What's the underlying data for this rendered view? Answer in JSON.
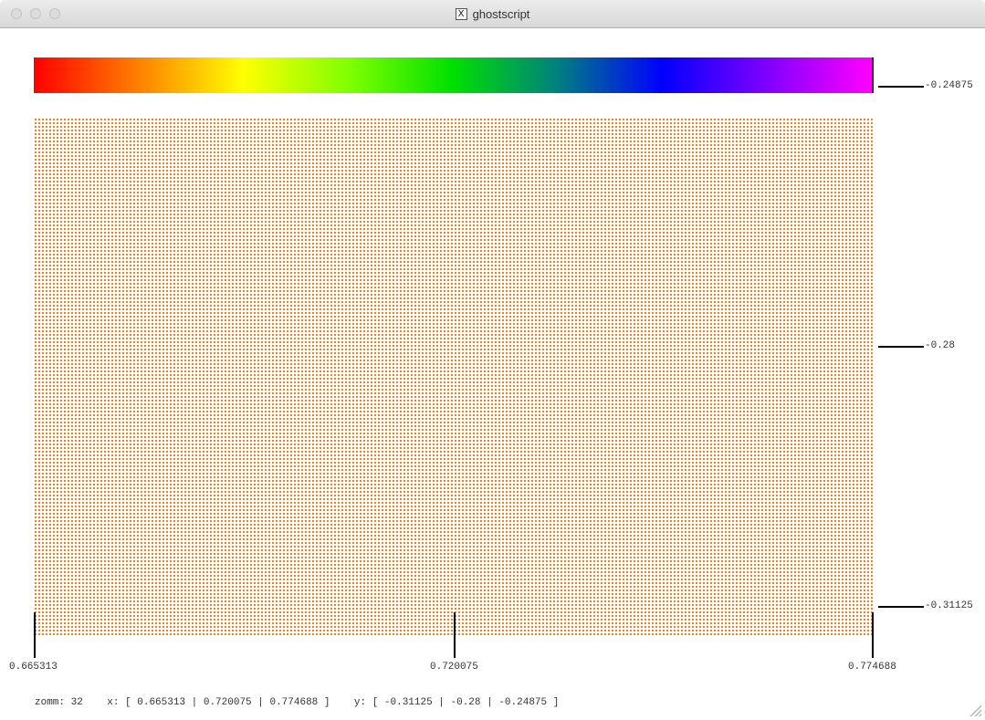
{
  "window": {
    "title": "ghostscript",
    "title_icon": "x11-icon",
    "title_icon_glyph": "X"
  },
  "colorbar": {
    "stops": [
      "#ff0000",
      "#ff8000",
      "#ffff00",
      "#80ff00",
      "#00e000",
      "#008080",
      "#0000ff",
      "#8000ff",
      "#ff00ff"
    ]
  },
  "plot": {
    "x_ticks": [
      "0.665313",
      "0.720075",
      "0.774688"
    ],
    "y_ticks": [
      "-0.24875",
      "-0.28",
      "-0.31125"
    ],
    "colors": {
      "inside": "#000000",
      "outside": "#f08020",
      "near": "#ffff00",
      "mid": "#80ff00",
      "green": "#00e000",
      "blue": "#0000ff",
      "purple": "#a000ff",
      "magenta": "#ff00ff"
    }
  },
  "status": {
    "zoom_label": "zomm:",
    "zoom_value": "32",
    "x_text": "x: [ 0.665313 | 0.720075 | 0.774688 ]",
    "y_text": "y: [ -0.31125 | -0.28 | -0.24875 ]"
  }
}
